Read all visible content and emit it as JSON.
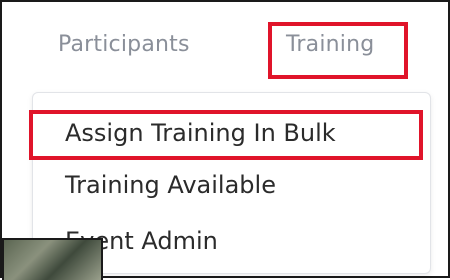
{
  "nav": {
    "items": [
      {
        "label": "Participants"
      },
      {
        "label": "Training"
      }
    ]
  },
  "dropdown": {
    "items": [
      {
        "label": "Assign Training In Bulk"
      },
      {
        "label": "Training Available"
      },
      {
        "label": "Event Admin"
      }
    ]
  },
  "colors": {
    "highlight": "#e0142a",
    "nav_text": "#8a8f99",
    "menu_text": "#2b2b2b"
  }
}
